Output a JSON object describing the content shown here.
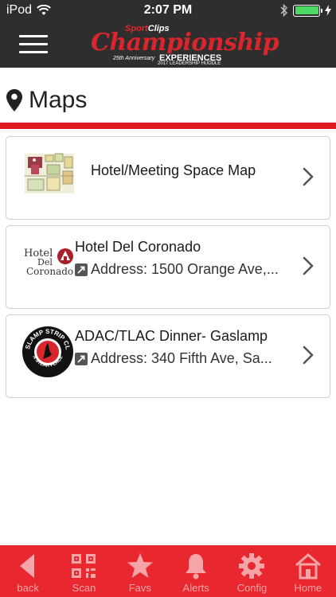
{
  "status": {
    "carrier": "iPod",
    "time": "2:07 PM",
    "battery_level": 1.0
  },
  "header": {
    "brand_sport": "Sport",
    "brand_clips": "Clips",
    "logo_title": "Championship",
    "logo_anniversary": "25th Anniversary",
    "logo_experiences": "EXPERIENCES",
    "logo_subtitle": "2017 LEADERSHIP HUDDLE"
  },
  "page": {
    "title": "Maps"
  },
  "cards": [
    {
      "name": "Hotel/Meeting Space Map",
      "address": ""
    },
    {
      "name": "Hotel Del Coronado",
      "address": "Address: 1500 Orange Ave,...",
      "logo_lines": [
        "Hotel",
        "Del",
        "Coronado"
      ]
    },
    {
      "name": "ADAC/TLAC Dinner- Gaslamp",
      "address": "Address: 340 Fifth Ave, Sa...",
      "logo_text_top": "GASLAMP STRIP CLUB",
      "logo_text_bottom": "A STEAK PLACE"
    }
  ],
  "tabs": [
    {
      "label": "back",
      "icon": "back-arrow-icon"
    },
    {
      "label": "Scan",
      "icon": "qr-code-icon"
    },
    {
      "label": "Favs",
      "icon": "star-icon"
    },
    {
      "label": "Alerts",
      "icon": "bell-icon"
    },
    {
      "label": "Config",
      "icon": "gear-icon"
    },
    {
      "label": "Home",
      "icon": "home-icon"
    }
  ],
  "colors": {
    "accent": "#e11b22",
    "header": "#2e2e2e",
    "tab_bar": "#e8282e",
    "tab_icon": "#f5a5a7"
  }
}
